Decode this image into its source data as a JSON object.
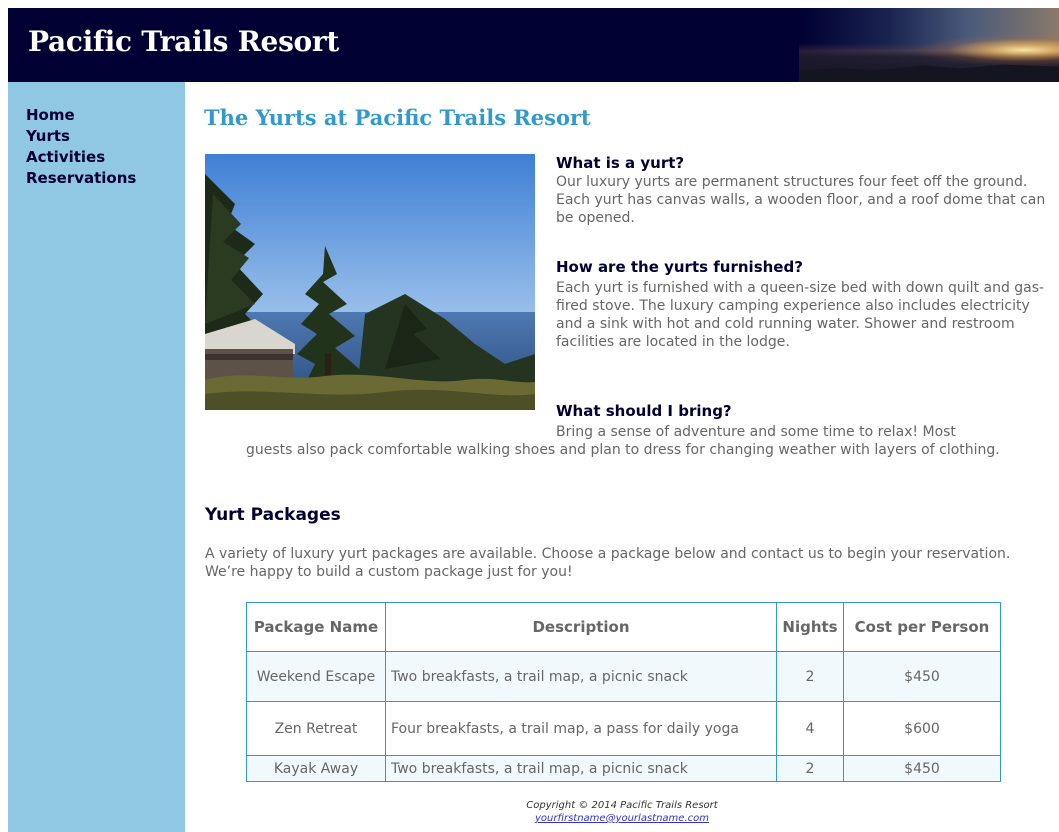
{
  "header": {
    "title": "Pacific Trails Resort"
  },
  "nav": {
    "items": [
      {
        "label": "Home"
      },
      {
        "label": "Yurts"
      },
      {
        "label": "Activities"
      },
      {
        "label": "Reservations"
      }
    ]
  },
  "main": {
    "title": "The Yurts at Pacific Trails Resort",
    "faq": [
      {
        "question": "What is a yurt?",
        "answer": "Our luxury yurts are permanent structures four feet off the ground. Each yurt has canvas walls, a wooden floor, and a roof dome that can be opened."
      },
      {
        "question": "How are the yurts furnished?",
        "answer": "Each yurt is furnished with a queen-size bed with down quilt and gas-fired stove. The luxury camping experience also includes electricity and a sink with hot and cold running water. Shower and restroom facilities are located in the lodge."
      },
      {
        "question": "What should I bring?",
        "answer_line1": "Bring a sense of adventure and some time to relax! Most",
        "answer_line2": "guests also pack comfortable walking shoes and plan to dress for changing weather with layers of clothing."
      }
    ],
    "packages": {
      "title": "Yurt Packages",
      "intro": "A variety of luxury yurt packages are available. Choose a package below and contact us to begin your reservation. We’re happy to build a custom package just for you!",
      "headers": [
        "Package Name",
        "Description",
        "Nights",
        "Cost per Person"
      ],
      "rows": [
        {
          "name": "Weekend Escape",
          "description": "Two breakfasts, a trail map, a picnic snack",
          "nights": "2",
          "cost": "$450"
        },
        {
          "name": "Zen Retreat",
          "description": "Four breakfasts, a trail map, a pass for daily yoga",
          "nights": "4",
          "cost": "$600"
        },
        {
          "name": "Kayak Away",
          "description": "Two breakfasts, a trail map, a picnic snack",
          "nights": "2",
          "cost": "$450"
        }
      ]
    }
  },
  "footer": {
    "copyright": "Copyright © 2014 Pacific Trails Resort",
    "email": "yourfirstname@yourlastname.com"
  },
  "colors": {
    "header_bg": "#000033",
    "nav_bg": "#90c7e3",
    "heading_accent": "#3399cc",
    "table_border": "#3399cc",
    "text_gray": "#666666"
  }
}
